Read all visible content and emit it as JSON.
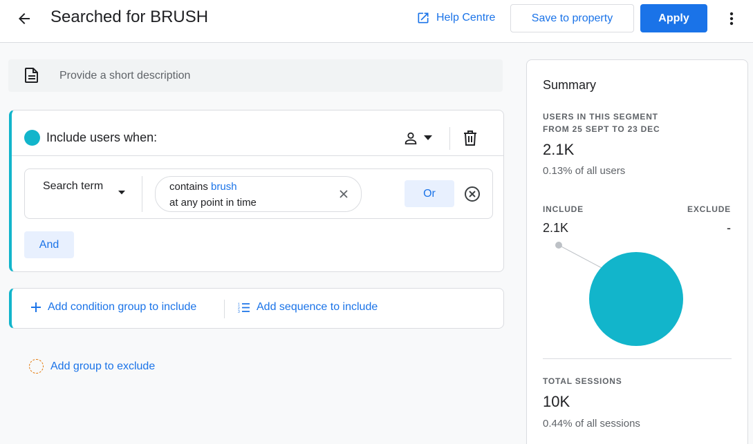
{
  "header": {
    "title": "Searched for BRUSH",
    "help_label": "Help Centre",
    "save_label": "Save to property",
    "apply_label": "Apply"
  },
  "description": {
    "placeholder": "Provide a short description"
  },
  "include_group": {
    "title": "Include users when:",
    "condition": {
      "dimension": "Search term",
      "operator": "contains",
      "value": "brush",
      "scope": "at any point in time"
    },
    "or_label": "Or",
    "and_label": "And"
  },
  "add_actions": {
    "condition_group": "Add condition group to include",
    "sequence": "Add sequence to include",
    "exclude": "Add group to exclude"
  },
  "summary": {
    "title": "Summary",
    "users_label_1": "USERS IN THIS SEGMENT",
    "users_label_2": "FROM 25 SEPT TO 23 DEC",
    "users_value": "2.1K",
    "users_sub": "0.13% of all users",
    "include_label": "INCLUDE",
    "include_value": "2.1K",
    "exclude_label": "EXCLUDE",
    "exclude_value": "-",
    "sessions_label": "TOTAL SESSIONS",
    "sessions_value": "10K",
    "sessions_sub": "0.44% of all sessions"
  },
  "colors": {
    "accent": "#1a73e8",
    "include": "#12b5cb",
    "exclude_ring": "#e37400"
  },
  "icons": [
    "arrow-back-icon",
    "open-in-new-icon",
    "more-vert-icon",
    "description-icon",
    "person-icon",
    "caret-down-icon",
    "delete-icon",
    "close-icon",
    "cancel-circle-icon",
    "plus-icon",
    "sequence-list-icon",
    "dashed-circle-icon"
  ]
}
